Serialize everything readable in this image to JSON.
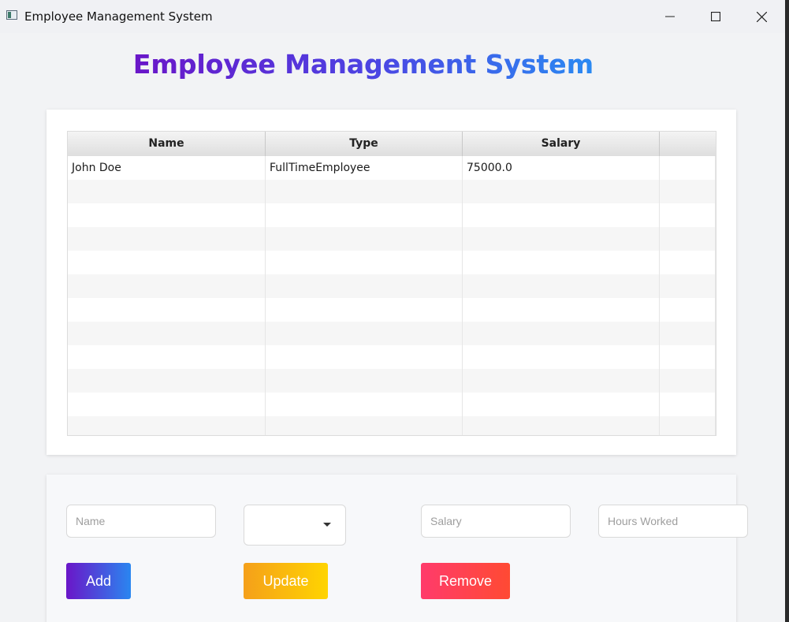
{
  "window": {
    "title": "Employee Management System",
    "controls": [
      "minimize",
      "maximize",
      "close"
    ]
  },
  "heading": "Employee Management System",
  "table": {
    "columns": [
      "Name",
      "Type",
      "Salary"
    ],
    "rows": [
      [
        "John Doe",
        "FullTimeEmployee",
        "75000.0"
      ]
    ]
  },
  "form": {
    "name_placeholder": "Name",
    "type_value": "",
    "salary_placeholder": "Salary",
    "hours_placeholder": "Hours Worked",
    "add_label": "Add",
    "update_label": "Update",
    "remove_label": "Remove"
  },
  "colors": {
    "heading_gradient": [
      "#6a16c8",
      "#2a86f0"
    ],
    "add_gradient": [
      "#6a16c8",
      "#2a86f0"
    ],
    "update_gradient": [
      "#f5a01a",
      "#ffd400"
    ],
    "remove_gradient": [
      "#ff3b6b",
      "#ff4a33"
    ]
  }
}
